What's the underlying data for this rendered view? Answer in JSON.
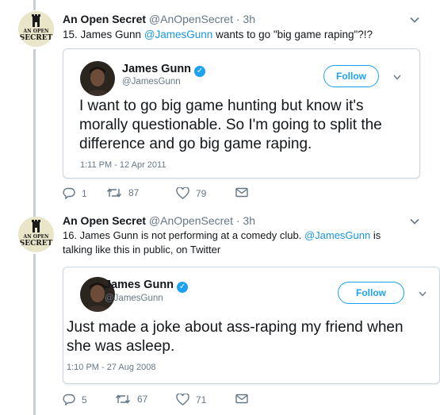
{
  "tweets": [
    {
      "author_name": "An Open Secret",
      "author_handle": "@AnOpenSecret",
      "time": "3h",
      "avatar_logo_lines": [
        "AN OPEN",
        "SECRET"
      ],
      "text_prefix": "15. James Gunn ",
      "text_mention": "@JamesGunn",
      "text_suffix": " wants to go \"big game raping\"?!?",
      "quote": {
        "name": "James Gunn",
        "handle": "@JamesGunn",
        "follow_label": "Follow",
        "text": "I want to go big game hunting but know it's morally questionable. So I'm going to split the difference and go big game raping.",
        "timestamp": "1:11 PM - 12 Apr 2011"
      },
      "replies": "1",
      "retweets": "87",
      "likes": "79"
    },
    {
      "author_name": "An Open Secret",
      "author_handle": "@AnOpenSecret",
      "time": "3h",
      "avatar_logo_lines": [
        "AN OPEN",
        "SECRET"
      ],
      "text_prefix": "16. James Gunn is not performing at a comedy club.  ",
      "text_mention": "@JamesGunn",
      "text_suffix": " is talking like this in public, on Twitter",
      "quote": {
        "name": "James Gunn",
        "handle": "@JamesGunn",
        "follow_label": "Follow",
        "text": "Just made a joke about ass-raping my friend when she was asleep.",
        "timestamp": "1:10 PM - 27 Aug 2008"
      },
      "replies": "5",
      "retweets": "67",
      "likes": "71"
    }
  ],
  "separator_dot": "·",
  "icons": {
    "reply": "reply-icon",
    "retweet": "retweet-icon",
    "like": "heart-icon",
    "dm": "envelope-icon",
    "caret": "chevron-down-icon",
    "verified": "verified-badge-icon"
  },
  "colors": {
    "link": "#1b95e0",
    "follow": "#1da1f2",
    "muted": "#657786",
    "thread_line": "#c4cfd6"
  }
}
